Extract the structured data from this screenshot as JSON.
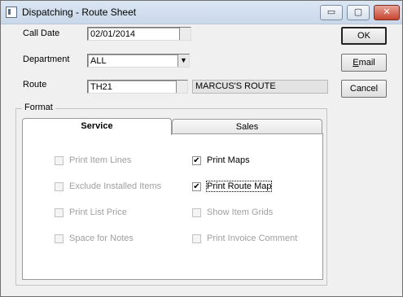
{
  "window": {
    "title": "Dispatching - Route Sheet",
    "controls": {
      "minimize": "▭",
      "maximize": "▢",
      "close": "✕"
    }
  },
  "fields": {
    "call_date_label": "Call Date",
    "call_date_value": "02/01/2014",
    "department_label": "Department",
    "department_value": "ALL",
    "route_label": "Route",
    "route_value": "TH21",
    "route_name": "MARCUS'S ROUTE"
  },
  "buttons": {
    "ok": "OK",
    "email_first": "E",
    "email_rest": "mail",
    "cancel": "Cancel"
  },
  "format": {
    "group_label": "Format",
    "tabs": {
      "service": "Service",
      "sales": "Sales"
    },
    "options": {
      "print_item_lines": {
        "label": "Print Item Lines",
        "checked": false,
        "enabled": false
      },
      "exclude_installed_items": {
        "label": "Exclude Installed Items",
        "checked": false,
        "enabled": false
      },
      "print_list_price": {
        "label": "Print List Price",
        "checked": false,
        "enabled": false
      },
      "space_for_notes": {
        "label": "Space for  Notes",
        "checked": false,
        "enabled": false
      },
      "print_maps": {
        "label": "Print Maps",
        "checked": true,
        "enabled": true
      },
      "print_route_map": {
        "label": "Print Route Map",
        "checked": true,
        "enabled": true
      },
      "show_item_grids": {
        "label": "Show Item Grids",
        "checked": false,
        "enabled": false
      },
      "print_invoice_comment": {
        "label": "Print Invoice Comment",
        "checked": false,
        "enabled": false
      }
    },
    "checkmark": "✔"
  }
}
